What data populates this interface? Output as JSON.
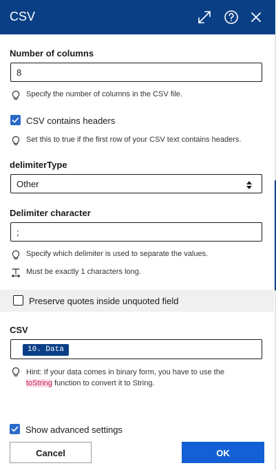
{
  "header": {
    "title": "CSV"
  },
  "num_columns": {
    "label": "Number of columns",
    "value": "8",
    "hint": "Specify the number of columns in the CSV file."
  },
  "headers_option": {
    "label": "CSV contains headers",
    "checked": true,
    "hint": "Set this to true if the first row of your CSV text contains headers."
  },
  "delimiter_type": {
    "label": "delimiterType",
    "selected": "Other"
  },
  "delimiter_char": {
    "label": "Delimiter character",
    "value": ";",
    "hint": "Specify which delimiter is used to separate the values.",
    "length_hint": "Must be exactly 1 characters long."
  },
  "preserve_quotes": {
    "label": "Preserve quotes inside unquoted field",
    "checked": false
  },
  "csv": {
    "label": "CSV",
    "token": "10. Data",
    "hint_before": "Hint: If your data comes in binary form, you have to use the",
    "hint_fn": "toString",
    "hint_after": " function to convert it to String."
  },
  "advanced": {
    "label": "Show advanced settings",
    "checked": true
  },
  "buttons": {
    "cancel": "Cancel",
    "ok": "OK"
  },
  "icons": {
    "expand": "expand-icon",
    "help": "help-icon",
    "close": "close-icon",
    "hint": "lightbulb-icon",
    "length": "text-length-icon",
    "select": "select-arrows-icon",
    "check": "checkmark-icon"
  },
  "colors": {
    "header_bg": "#0a3f86",
    "primary_button": "#1360d4",
    "checkbox": "#2a6bc9",
    "token_bg": "#0a3f86"
  }
}
